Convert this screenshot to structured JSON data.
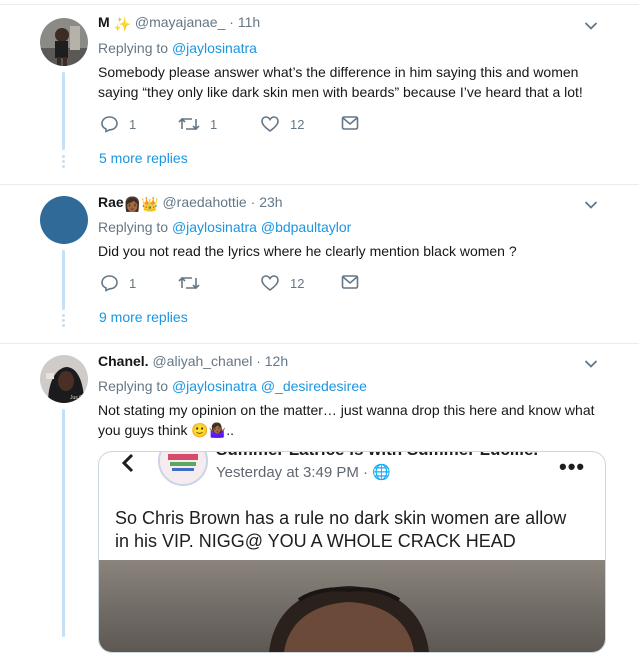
{
  "tweets": [
    {
      "name": "M",
      "name_emoji": "✨",
      "handle": "@mayajanae_",
      "time": "11h",
      "replying_label": "Replying to",
      "mentions": [
        "@jaylosinatra"
      ],
      "text": "Somebody please answer what’s the difference in him saying this and women saying “they only like dark skin men with beards” because I’ve heard that a lot!",
      "reply_count": "1",
      "retweet_count": "1",
      "like_count": "12",
      "more_replies": "5 more replies"
    },
    {
      "name": "Rae",
      "name_emoji": "👩🏾👑",
      "handle": "@raedahottie",
      "time": "23h",
      "replying_label": "Replying to",
      "mentions": [
        "@jaylosinatra",
        "@bdpaultaylor"
      ],
      "text": "Did you not read the lyrics where he clearly mention black women ?",
      "reply_count": "1",
      "retweet_count": "",
      "like_count": "12",
      "more_replies": "9 more replies"
    },
    {
      "name": "Chanel.",
      "handle": "@aliyah_chanel",
      "time": "12h",
      "replying_label": "Replying to",
      "mentions": [
        "@jaylosinatra",
        "@_desiredesiree"
      ],
      "text": "Not stating my opinion on the matter… just wanna drop this here and know what you guys think 🙂🤷🏾‍♀️..",
      "card": {
        "header": "Summer Latrice is with Summer Lucille.",
        "sub": "Yesterday at 3:49 PM · 🌐",
        "menu": "•••",
        "text": "So Chris Brown has a rule no dark skin women are allow in his VIP. NIGG@ YOU A WHOLE CRACK HEAD"
      }
    }
  ],
  "colors": {
    "link": "#1b95e0",
    "muted": "#657786",
    "thread": "#c4e0f5",
    "divider": "#e6ecf0"
  },
  "icons": [
    "chevron-down-icon",
    "reply-icon",
    "retweet-icon",
    "like-icon",
    "dm-icon",
    "back-icon",
    "globe-icon"
  ]
}
